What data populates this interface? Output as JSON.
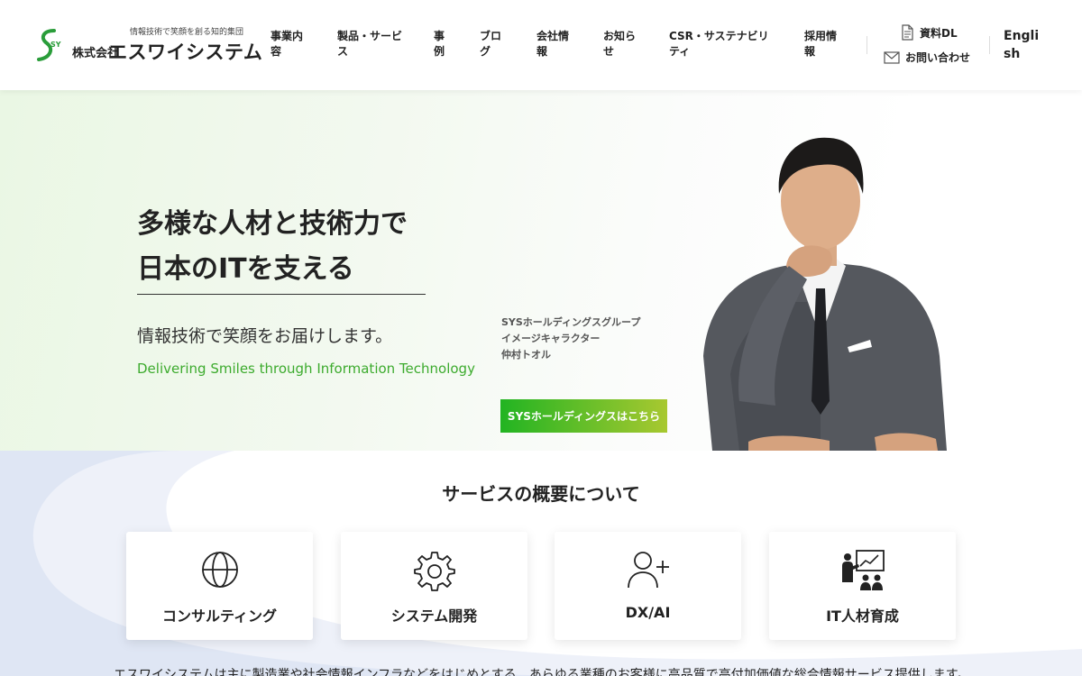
{
  "header": {
    "logo": {
      "tagline": "情報技術で笑顔を創る知的集団",
      "kabushiki": "株式会社",
      "name": "エスワイシステム",
      "mark_text": "SYS"
    },
    "nav": [
      {
        "label": "事業内容"
      },
      {
        "label": "製品・サービス"
      },
      {
        "label": "事例"
      },
      {
        "label": "ブログ"
      },
      {
        "label": "会社情報"
      },
      {
        "label": "お知らせ"
      },
      {
        "label": "CSR・サステナビリティ"
      },
      {
        "label": "採用情報"
      }
    ],
    "download_label": "資料DL",
    "contact_label": "お問い合わせ",
    "english_label": "English"
  },
  "hero": {
    "title_line1": "多様な人材と技術力で",
    "title_line2": "日本のITを支える",
    "lead": "情報技術で笑顔をお届けします。",
    "english_lead": "Delivering Smiles through Information Technology",
    "character_line1": "SYSホールディングスグループ",
    "character_line2": "イメージキャラクター",
    "character_line3": "仲村トオル",
    "cta_label": "SYSホールディングスはこちら"
  },
  "services": {
    "title": "サービスの概要について",
    "cards": [
      {
        "label": "コンサルティング",
        "icon": "globe-icon"
      },
      {
        "label": "システム開発",
        "icon": "gear-icon"
      },
      {
        "label": "DX/AI",
        "icon": "user-plus-icon"
      },
      {
        "label": "IT人材育成",
        "icon": "presentation-icon"
      }
    ],
    "intro": "エスワイシステムは主に製造業や社会情報インフラなどをはじめとする、あらゆる業種のお客様に高品質で高付加価値な総合情報サービス提供します。"
  },
  "colors": {
    "accent_green": "#3dab2e",
    "button_gradient_start": "#22b422",
    "button_gradient_end": "#a8c830",
    "services_bg": "#dfe6f4"
  }
}
